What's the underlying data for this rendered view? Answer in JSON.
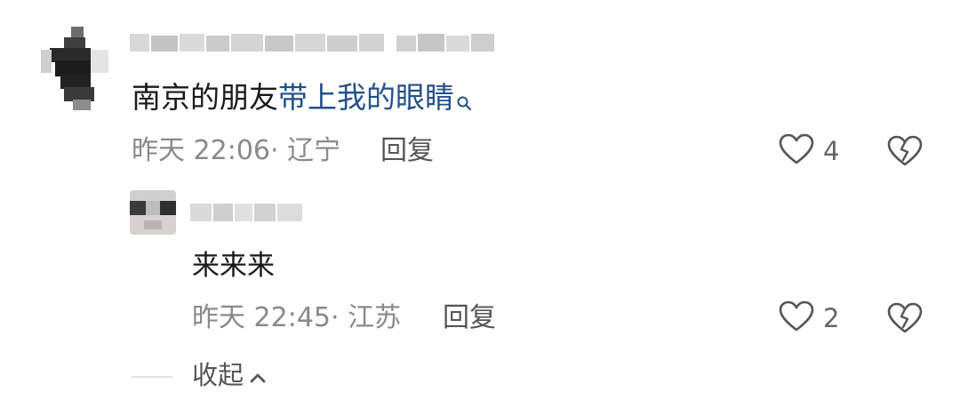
{
  "comment": {
    "text_plain": "南京的朋友",
    "text_link": "带上我的眼睛",
    "search_icon": "search-icon",
    "time": "昨天 22:06",
    "location": "· 辽宁",
    "reply_label": "回复",
    "like_count": "4",
    "like_icon": "heart-outline-icon",
    "dislike_icon": "broken-heart-icon"
  },
  "reply": {
    "text": "来来来",
    "time": "昨天 22:45",
    "location": "· 江苏",
    "reply_label": "回复",
    "like_count": "2",
    "like_icon": "heart-outline-icon",
    "dislike_icon": "broken-heart-icon"
  },
  "collapse": {
    "label": "收起",
    "icon": "chevron-up-icon"
  },
  "colors": {
    "link": "#24508a",
    "meta": "#8a8a8a",
    "reply": "#555555",
    "icon": "#555555"
  }
}
